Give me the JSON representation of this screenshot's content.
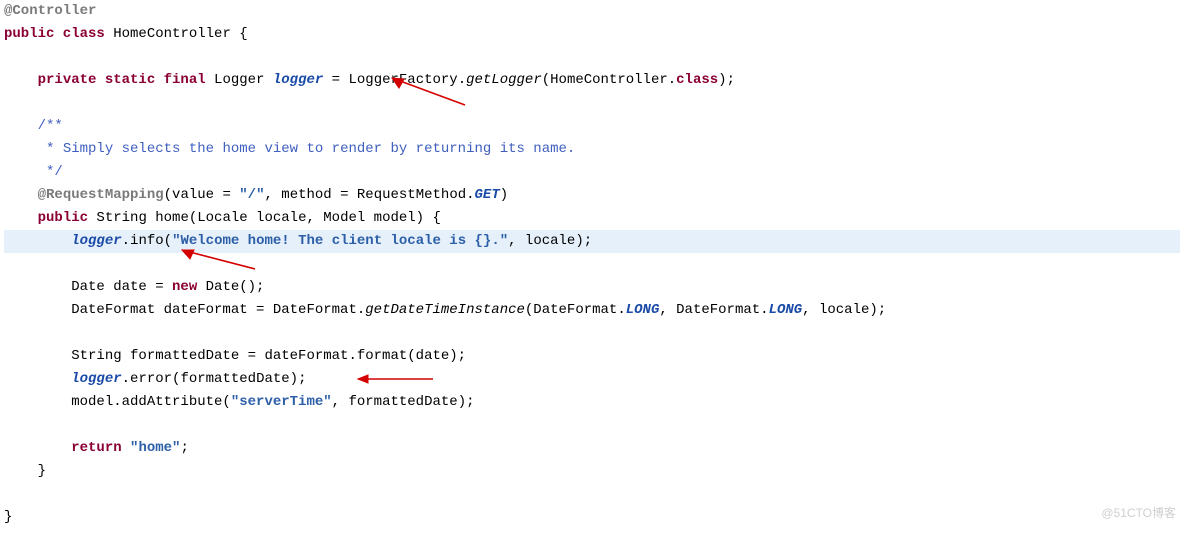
{
  "code": {
    "l1_annotation": "@Controller",
    "l2_kw1": "public class",
    "l2_cls": " HomeController {",
    "l4_a": "    ",
    "l4_kw": "private static final",
    "l4_b": " Logger ",
    "l4_field": "logger",
    "l4_c": " = LoggerFactory.",
    "l4_m": "getLogger",
    "l4_d": "(HomeController.",
    "l4_kw2": "class",
    "l4_e": ");",
    "l6_a": "    ",
    "l6_c": "/**",
    "l7_a": "     ",
    "l7_c": "* Simply selects the home view to render by returning its name.",
    "l8_a": "     ",
    "l8_c": "*/",
    "l9_a": "    ",
    "l9_ann": "@RequestMapping",
    "l9_b": "(value = ",
    "l9_s": "\"/\"",
    "l9_c": ", method = RequestMethod.",
    "l9_const": "GET",
    "l9_d": ")",
    "l10_a": "    ",
    "l10_kw": "public",
    "l10_b": " String home(Locale locale, Model model) {",
    "l11_a": "        ",
    "l11_f": "logger",
    "l11_b": ".info(",
    "l11_s": "\"Welcome home! The client locale is {}.\"",
    "l11_c": ", locale);",
    "l13_a": "        Date date = ",
    "l13_kw": "new",
    "l13_b": " Date();",
    "l14_a": "        DateFormat dateFormat = DateFormat.",
    "l14_m": "getDateTimeInstance",
    "l14_b": "(DateFormat.",
    "l14_c1": "LONG",
    "l14_c": ", DateFormat.",
    "l14_c2": "LONG",
    "l14_d": ", locale);",
    "l16_a": "        String formattedDate = dateFormat.format(date);",
    "l17_a": "        ",
    "l17_f": "logger",
    "l17_b": ".error(formattedDate);",
    "l18_a": "        model.addAttribute(",
    "l18_s": "\"serverTime\"",
    "l18_b": ", formattedDate);",
    "l20_a": "        ",
    "l20_kw": "return",
    "l20_b": " ",
    "l20_s": "\"home\"",
    "l20_c": ";",
    "l21": "    }",
    "l23": "}"
  },
  "watermark": "@51CTO博客"
}
